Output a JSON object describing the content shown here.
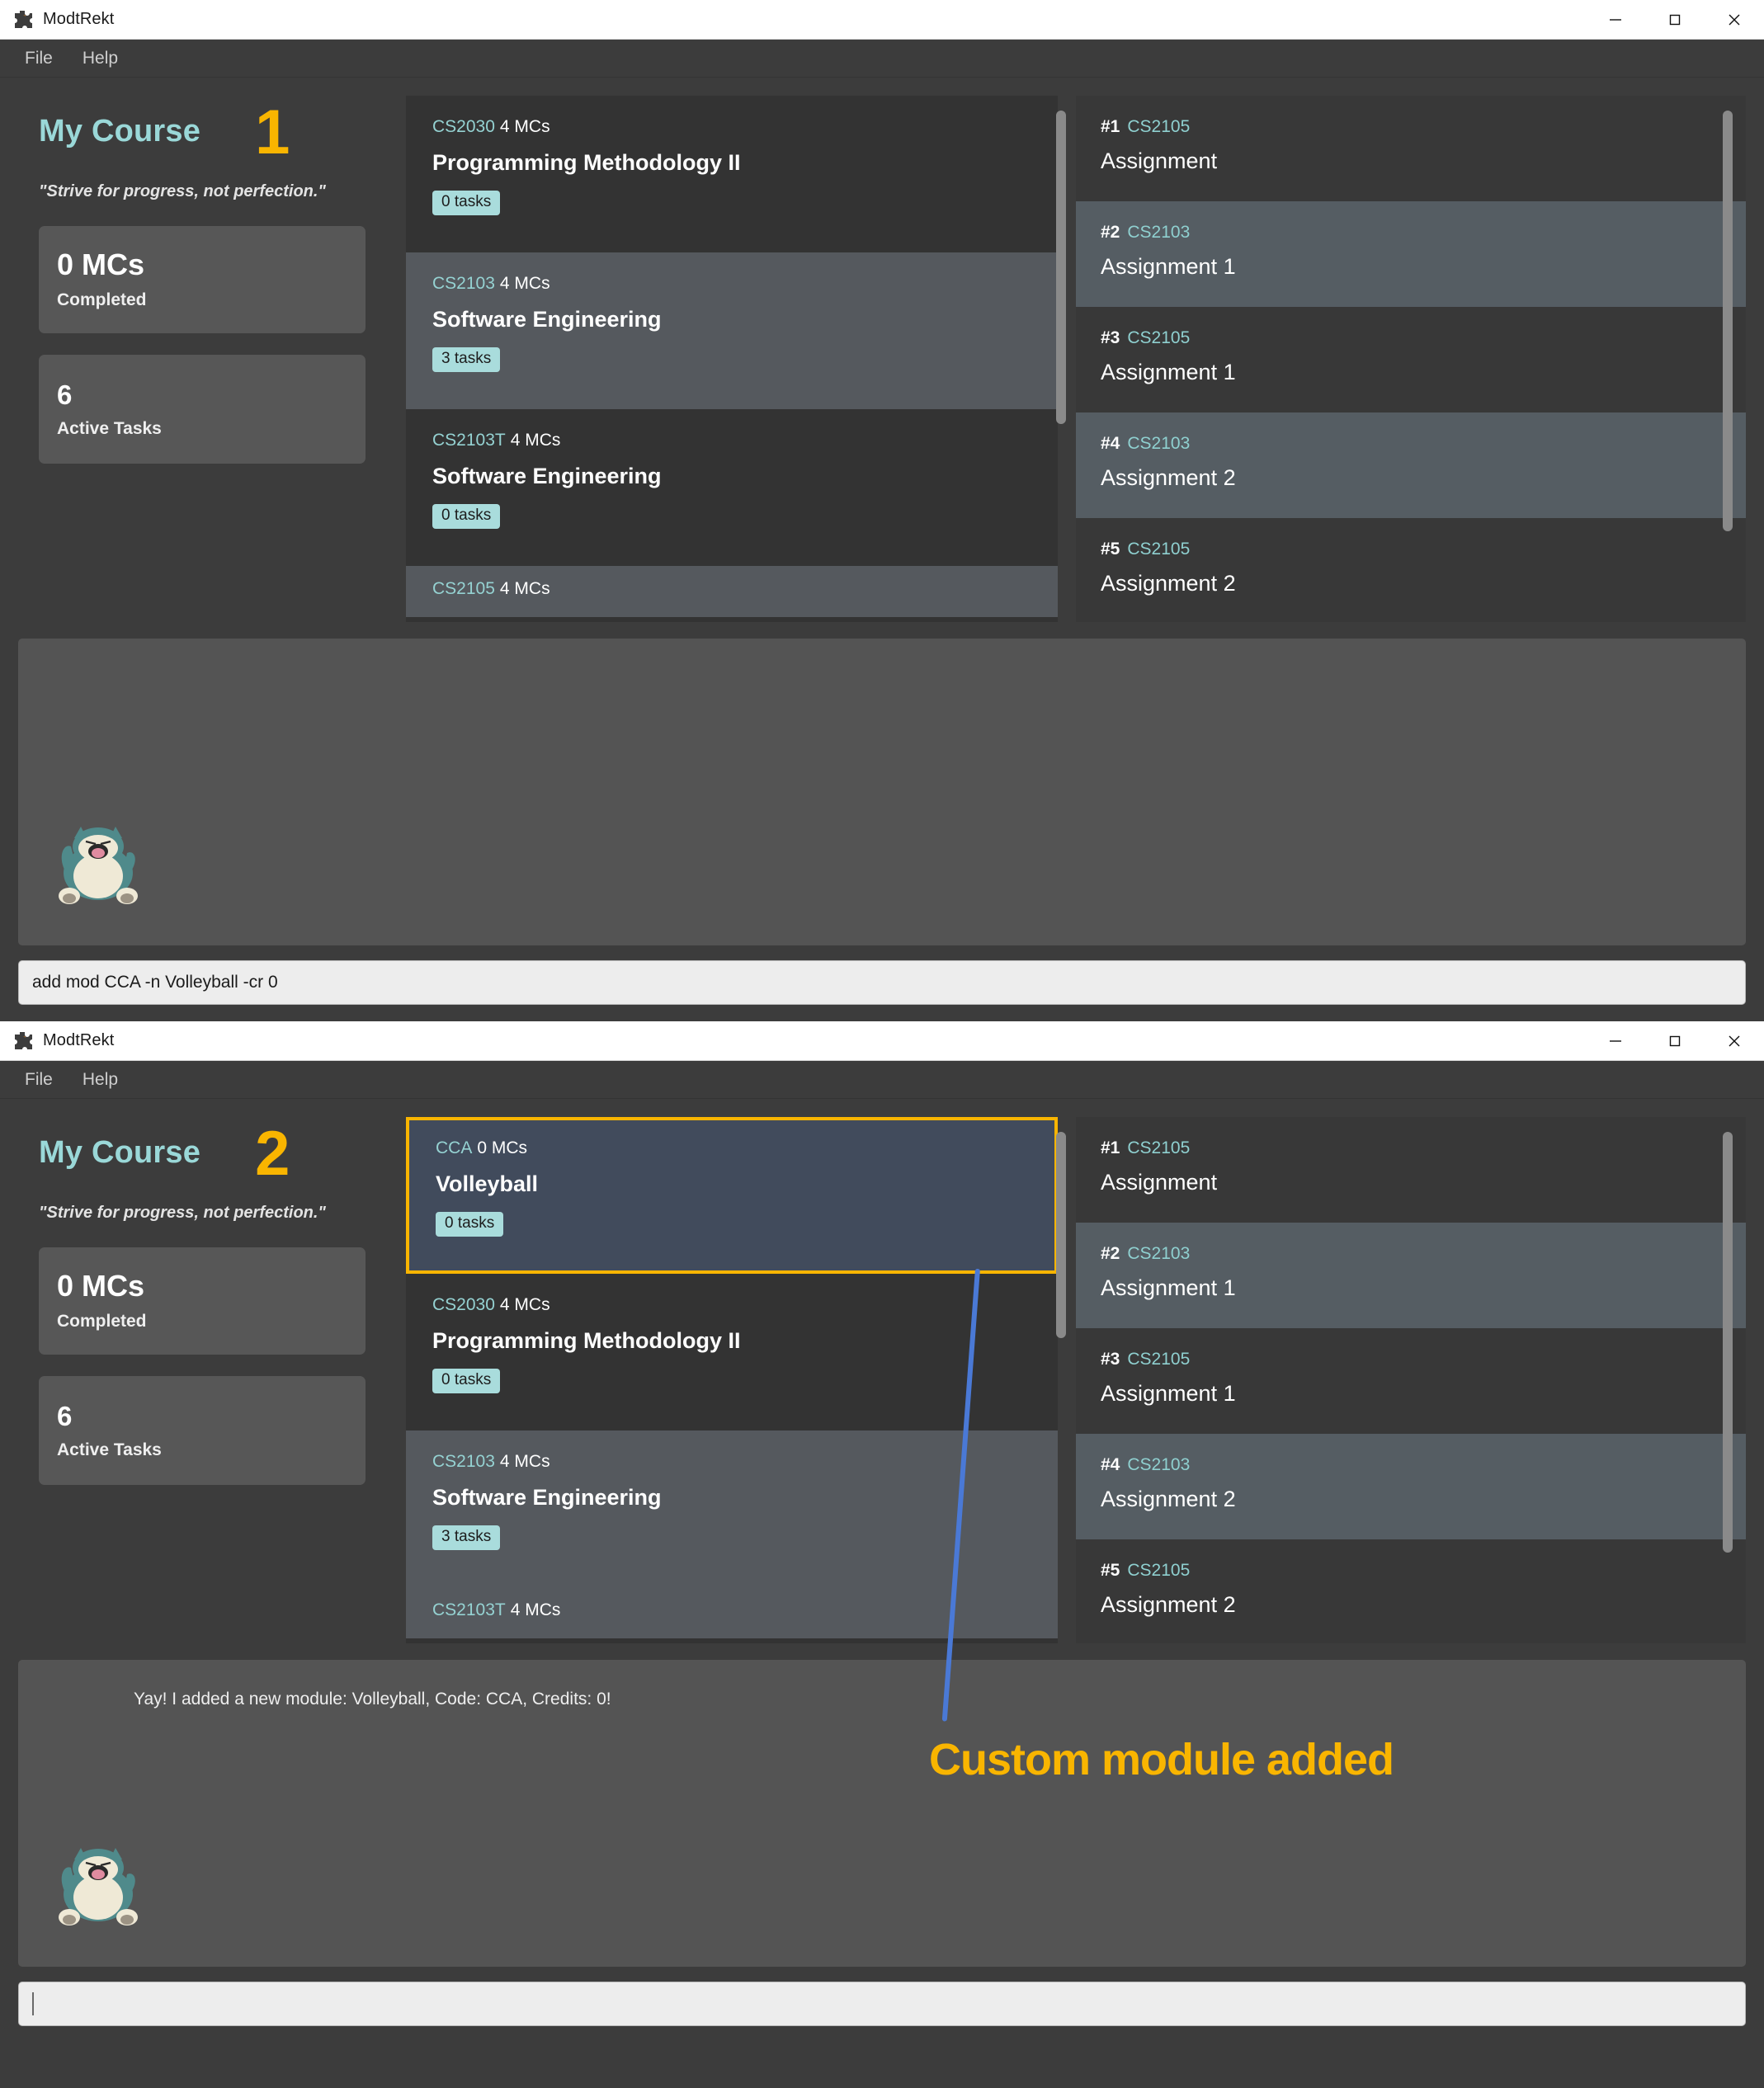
{
  "window_title": "ModtRekt",
  "menu": [
    "File",
    "Help"
  ],
  "window_controls": {
    "minimize": "minimize-icon",
    "maximize": "maximize-icon",
    "close": "close-icon"
  },
  "sidebar": {
    "heading": "My Course",
    "quote": "\"Strive for progress, not perfection.\"",
    "stats": [
      {
        "value": "0 MCs",
        "label": "Completed"
      },
      {
        "value": "6",
        "label": "Active Tasks"
      }
    ]
  },
  "colors": {
    "accent_teal": "#9ad8d8",
    "accent_yellow": "#f9b500",
    "annotation_blue": "#4a79d6",
    "selected_card": "#414b5c",
    "task_badge": "#a9dcdc"
  },
  "panel_1": {
    "step": "1",
    "modules": [
      {
        "code": "CS2030",
        "mcs": "4 MCs",
        "name": "Programming Methodology II",
        "tasks": "0 tasks",
        "style": "normal"
      },
      {
        "code": "CS2103",
        "mcs": "4 MCs",
        "name": "Software Engineering",
        "tasks": "3 tasks",
        "style": "alt"
      },
      {
        "code": "CS2103T",
        "mcs": "4 MCs",
        "name": "Software Engineering",
        "tasks": "0 tasks",
        "style": "normal"
      },
      {
        "code": "CS2105",
        "mcs": "4 MCs",
        "name": "",
        "tasks": "",
        "style": "partial-alt"
      }
    ],
    "tasks": [
      {
        "num": "#1",
        "code": "CS2105",
        "name": "Assignment",
        "style": "normal"
      },
      {
        "num": "#2",
        "code": "CS2103",
        "name": "Assignment 1",
        "style": "alt"
      },
      {
        "num": "#3",
        "code": "CS2105",
        "name": "Assignment 1",
        "style": "normal"
      },
      {
        "num": "#4",
        "code": "CS2103",
        "name": "Assignment 2",
        "style": "alt"
      },
      {
        "num": "#5",
        "code": "CS2105",
        "name": "Assignment 2",
        "style": "normal"
      }
    ],
    "output_message": "",
    "command_value": "add mod CCA -n Volleyball -cr 0",
    "mascot": "snorlax-icon"
  },
  "panel_2": {
    "step": "2",
    "modules": [
      {
        "code": "CCA",
        "mcs": "0 MCs",
        "name": "Volleyball",
        "tasks": "0 tasks",
        "style": "selected"
      },
      {
        "code": "CS2030",
        "mcs": "4 MCs",
        "name": "Programming Methodology II",
        "tasks": "0 tasks",
        "style": "normal"
      },
      {
        "code": "CS2103",
        "mcs": "4 MCs",
        "name": "Software Engineering",
        "tasks": "3 tasks",
        "style": "alt"
      },
      {
        "code": "CS2103T",
        "mcs": "4 MCs",
        "name": "",
        "tasks": "",
        "style": "partial-alt"
      }
    ],
    "tasks": [
      {
        "num": "#1",
        "code": "CS2105",
        "name": "Assignment",
        "style": "normal"
      },
      {
        "num": "#2",
        "code": "CS2103",
        "name": "Assignment 1",
        "style": "alt"
      },
      {
        "num": "#3",
        "code": "CS2105",
        "name": "Assignment 1",
        "style": "normal"
      },
      {
        "num": "#4",
        "code": "CS2103",
        "name": "Assignment 2",
        "style": "alt"
      },
      {
        "num": "#5",
        "code": "CS2105",
        "name": "Assignment 2",
        "style": "normal"
      }
    ],
    "output_message": "Yay! I added a new module: Volleyball, Code: CCA, Credits: 0!",
    "command_value": "",
    "annotation": "Custom module added",
    "mascot": "snorlax-icon"
  }
}
